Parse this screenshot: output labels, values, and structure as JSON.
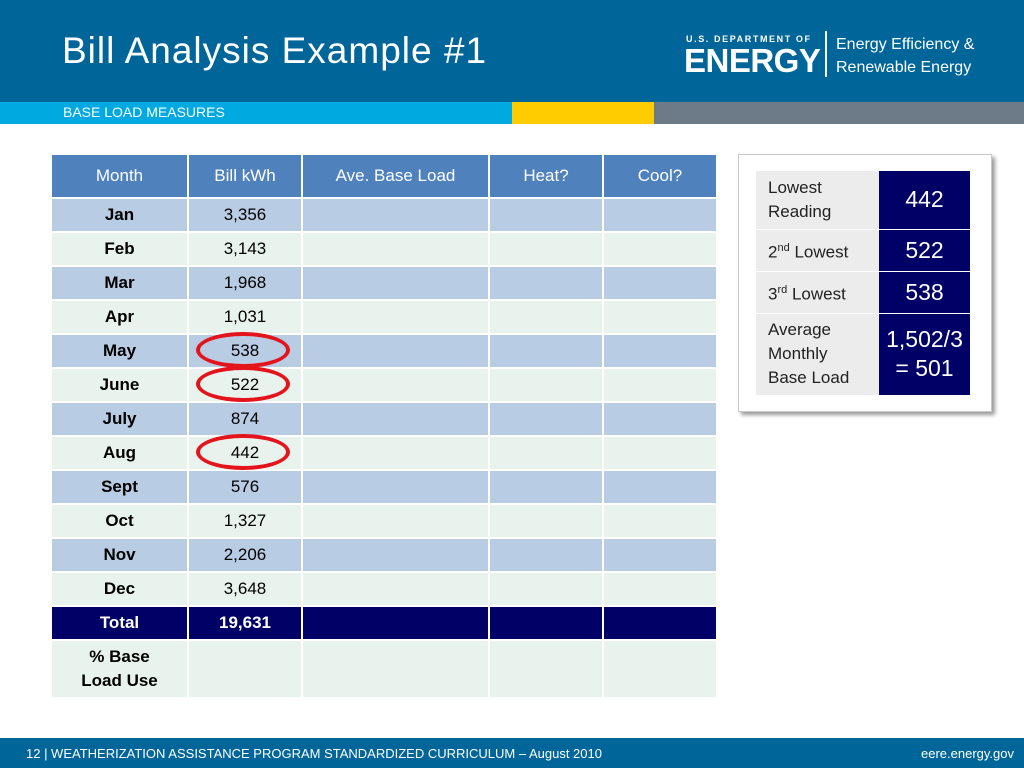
{
  "header": {
    "title": "Bill Analysis Example #1",
    "logo_small": "U.S. DEPARTMENT OF",
    "logo_big": "ENERGY",
    "eere_line1": "Energy Efficiency &",
    "eere_line2": "Renewable Energy",
    "subtitle": "BASE LOAD MEASURES"
  },
  "table": {
    "headers": [
      "Month",
      "Bill kWh",
      "Ave. Base Load",
      "Heat?",
      "Cool?"
    ],
    "rows": [
      {
        "month": "Jan",
        "kwh": "3,356"
      },
      {
        "month": "Feb",
        "kwh": "3,143"
      },
      {
        "month": "Mar",
        "kwh": "1,968"
      },
      {
        "month": "Apr",
        "kwh": "1,031"
      },
      {
        "month": "May",
        "kwh": "538"
      },
      {
        "month": "June",
        "kwh": "522"
      },
      {
        "month": "July",
        "kwh": "874"
      },
      {
        "month": "Aug",
        "kwh": "442"
      },
      {
        "month": "Sept",
        "kwh": "576"
      },
      {
        "month": "Oct",
        "kwh": "1,327"
      },
      {
        "month": "Nov",
        "kwh": "2,206"
      },
      {
        "month": "Dec",
        "kwh": "3,648"
      }
    ],
    "total_label": "Total",
    "total_value": "19,631",
    "pct_label_1": "% Base",
    "pct_label_2": "Load Use"
  },
  "summary": {
    "lowest_1": "Lowest",
    "lowest_2": "Reading",
    "lowest_value": "442",
    "second_num": "2",
    "second_sup": "nd",
    "second_text": " Lowest",
    "second_value": "522",
    "third_num": "3",
    "third_sup": "rd",
    "third_text": " Lowest",
    "third_value": "538",
    "avg_1": "Average",
    "avg_2": "Monthly",
    "avg_3": "Base Load",
    "avg_value_1": "1,502/3",
    "avg_value_2": "= 501"
  },
  "footer": {
    "left": "12 | WEATHERIZATION ASSISTANCE PROGRAM STANDARDIZED CURRICULUM – August 2010",
    "right": "eere.energy.gov"
  },
  "colors": {
    "header_blue": "#006699",
    "accent_cyan": "#00a9e0",
    "accent_yellow": "#ffcc00",
    "accent_gray": "#6d7b88",
    "table_header": "#4f81bd",
    "band_blue": "#b8cce4",
    "band_green": "#e9f3ee",
    "navy": "#000066",
    "highlight_red": "#e3141b"
  },
  "highlighted_months": [
    "May",
    "June",
    "Aug"
  ]
}
